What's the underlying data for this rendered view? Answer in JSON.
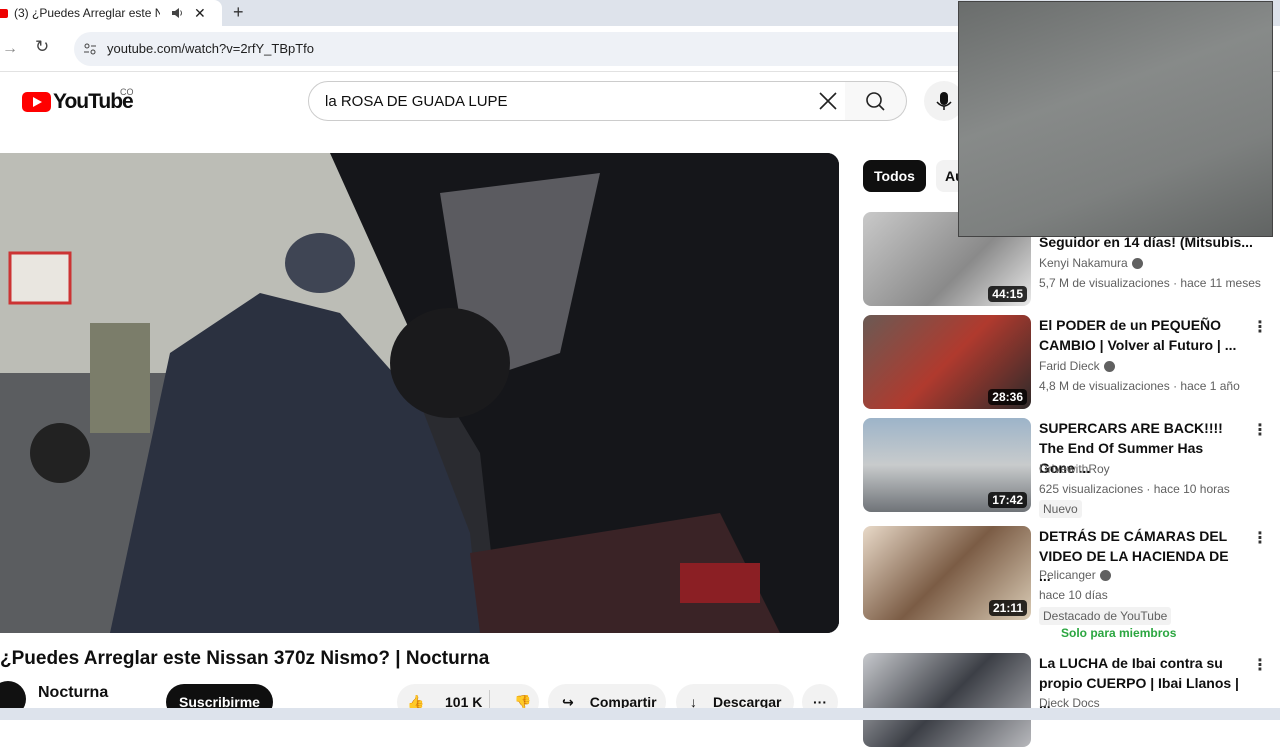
{
  "browser": {
    "tab_title": "(3) ¿Puedes Arreglar este N",
    "new_tab": "+",
    "close_tab": "✕",
    "url": "youtube.com/watch?v=2rfY_TBpTfo"
  },
  "youtube": {
    "logo_text": "YouTube",
    "country": "CO",
    "search_value": "la ROSA DE GUADA LUPE",
    "video": {
      "title": "¿Puedes Arreglar este Nissan 370z Nismo? | Nocturna",
      "channel": "Nocturna",
      "subscribe": "Suscribirme",
      "likes": "101 K",
      "share": "Compartir",
      "download": "Descargar",
      "more": "···"
    },
    "chips": [
      "Todos",
      "Au"
    ],
    "recommendations": [
      {
        "title": "Seguidor en 14 días! (Mitsubis...",
        "channel": "Kenyi Nakamura",
        "meta": "5,7 M de visualizaciones · hace 11 meses",
        "duration": "44:15"
      },
      {
        "title": "El PODER de un PEQUEÑO CAMBIO | Volver al Futuro | ...",
        "channel": "Farid Dieck",
        "meta": "4,8 M de visualizaciones · hace 1 año",
        "duration": "28:36"
      },
      {
        "title": "SUPERCARS ARE BACK!!!! The End Of Summer Has Gone ...",
        "channel": "DrivewithRoy",
        "meta": "625 visualizaciones · hace 10 horas",
        "duration": "17:42",
        "badge": "Nuevo"
      },
      {
        "title": "DETRÁS DE CÁMARAS DEL VIDEO DE LA HACIENDA DE ...",
        "channel": "Pelicanger",
        "meta": "hace 10 días",
        "duration": "21:11",
        "badge": "Destacado de YouTube",
        "members": "Solo para miembros"
      },
      {
        "title": "La LUCHA de Ibai contra su propio CUERPO | Ibai Llanos | ...",
        "channel": "Dieck Docs",
        "meta": "",
        "duration": ""
      }
    ]
  },
  "colors": {
    "brand_red": "#ff0000",
    "members_green": "#2ba640"
  }
}
